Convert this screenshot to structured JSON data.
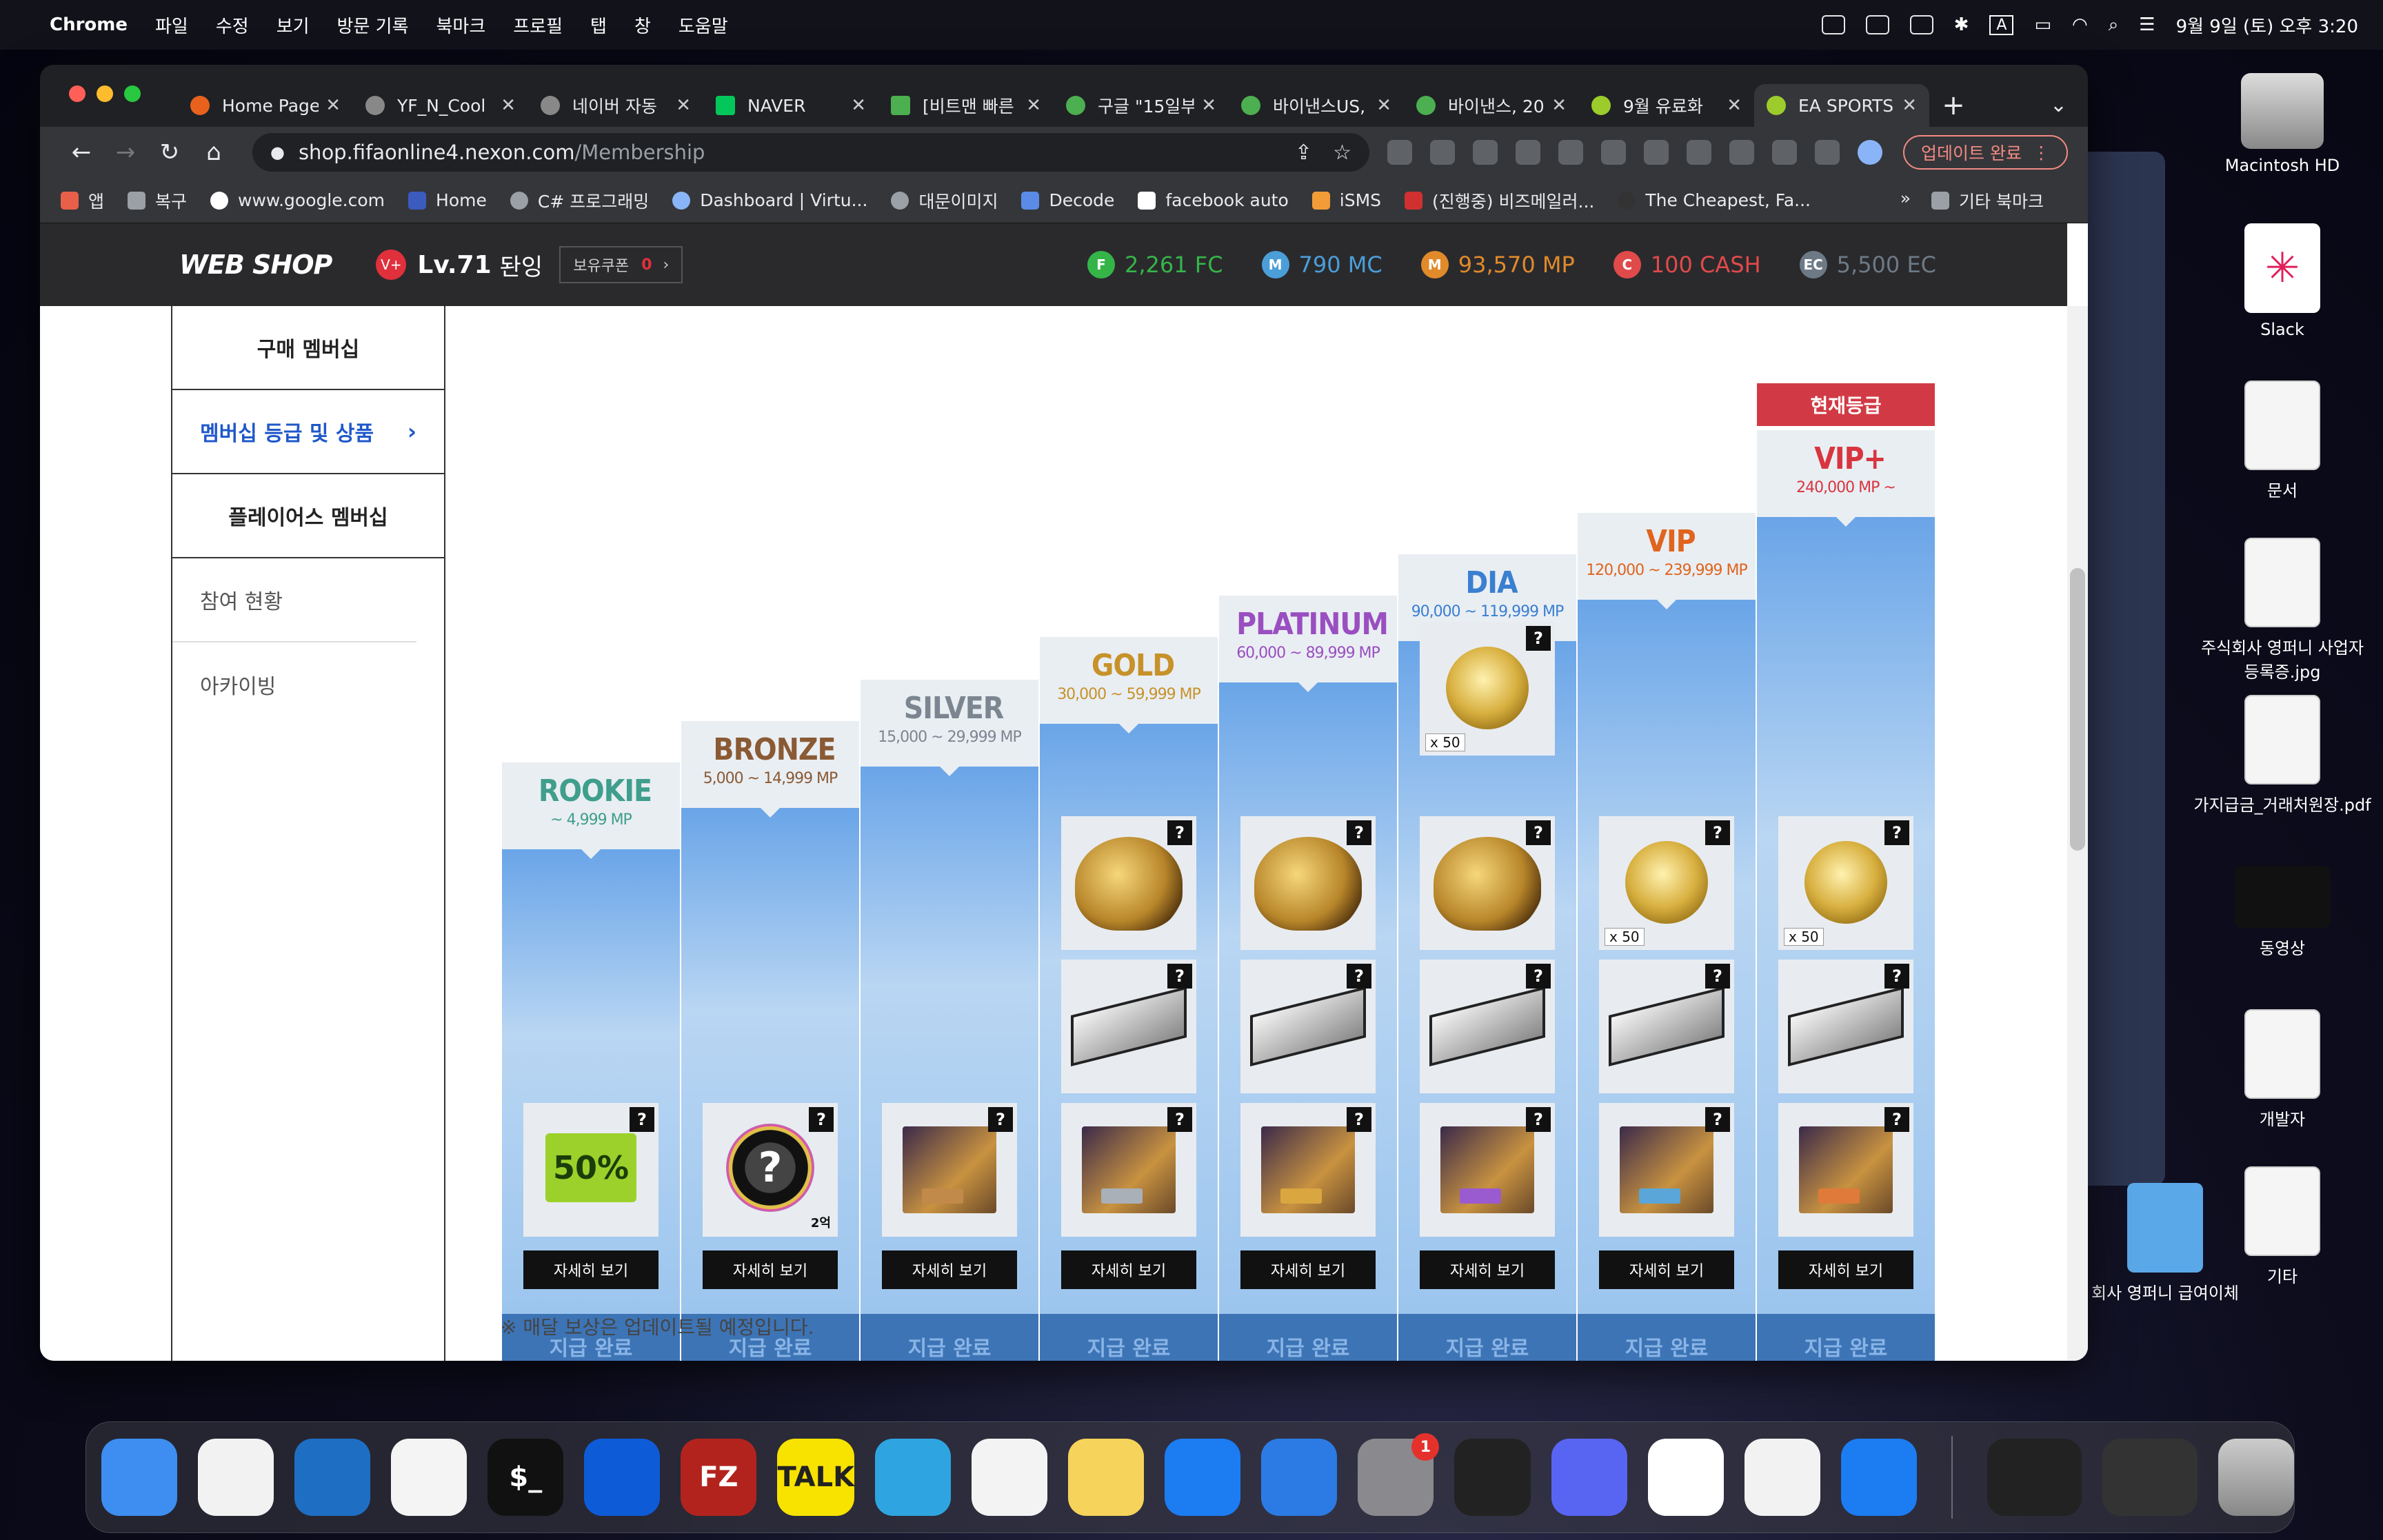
{
  "menubar": {
    "app": "Chrome",
    "items": [
      "파일",
      "수정",
      "보기",
      "방문 기록",
      "북마크",
      "프로필",
      "탭",
      "창",
      "도움말"
    ],
    "clock": "9월 9일 (토) 오후 3:20",
    "input_indicator": "A"
  },
  "tabs": [
    {
      "title": "Home Page"
    },
    {
      "title": "YF_N_Cool"
    },
    {
      "title": "네이버 자동"
    },
    {
      "title": "NAVER"
    },
    {
      "title": "[비트맨 빠른"
    },
    {
      "title": "구글 \"15일부"
    },
    {
      "title": "바이낸스US,"
    },
    {
      "title": "바이낸스, 20"
    },
    {
      "title": "9월 유료화"
    },
    {
      "title": "EA SPORTS"
    }
  ],
  "toolbar": {
    "url_host": "shop.fifaonline4.nexon.com",
    "url_path": "/Membership",
    "update_label": "업데이트 완료"
  },
  "bookmarks": [
    "앱",
    "복구",
    "www.google.com",
    "Home",
    "C# 프로그래밍",
    "Dashboard | Virtu...",
    "대문이미지",
    "Decode",
    "facebook auto",
    "iSMS",
    "(진행중) 비즈메일러...",
    "The Cheapest, Fa..."
  ],
  "bookmarks_more": "»",
  "bookmarks_other": "기타 북마크",
  "shop": {
    "logo": "WEB SHOP",
    "level": "Lv.71",
    "user": "돤잉",
    "coupon_label": "보유쿠폰",
    "coupon_count": "0",
    "currencies": [
      {
        "icon": "F",
        "label": "2,261 FC",
        "color": "#35b548"
      },
      {
        "icon": "M",
        "label": "790 MC",
        "color": "#4b9ed8"
      },
      {
        "icon": "M",
        "label": "93,570 MP",
        "color": "#e08a2a"
      },
      {
        "icon": "C",
        "label": "100 CASH",
        "color": "#e04a4a"
      },
      {
        "icon": "EC",
        "label": "5,500 EC",
        "color": "#6d7a86"
      }
    ]
  },
  "sidebar": {
    "items": [
      "구매 멤버십",
      "멤버십 등급 및 상품",
      "플레이어스 멤버십"
    ],
    "subs": [
      "참여 현황",
      "아카이빙"
    ]
  },
  "tiers": [
    {
      "name": "ROOKIE",
      "range": "~ 4,999 MP",
      "color": "#3f9e8c",
      "status": "지급 완료",
      "detail": "자세히 보기"
    },
    {
      "name": "BRONZE",
      "range": "5,000 ~ 14,999 MP",
      "color": "#8a5a34",
      "status": "지급 완료",
      "detail": "자세히 보기"
    },
    {
      "name": "SILVER",
      "range": "15,000 ~ 29,999 MP",
      "color": "#7c8690",
      "status": "지급 완료",
      "detail": "자세히 보기"
    },
    {
      "name": "GOLD",
      "range": "30,000 ~ 59,999 MP",
      "color": "#c7922a",
      "status": "지급 완료",
      "detail": "자세히 보기"
    },
    {
      "name": "PLATINUM",
      "range": "60,000 ~ 89,999 MP",
      "color": "#9a4fc0",
      "status": "지급 완료",
      "detail": "자세히 보기"
    },
    {
      "name": "DIA",
      "range": "90,000 ~ 119,999 MP",
      "color": "#3a7fd0",
      "status": "지급 완료",
      "detail": "자세히 보기"
    },
    {
      "name": "VIP",
      "range": "120,000 ~ 239,999 MP",
      "color": "#e0641e",
      "status": "지급 완료",
      "detail": "자세히 보기"
    },
    {
      "name": "VIP+",
      "range": "240,000 MP ~",
      "color": "#d8353f",
      "status": "지급 완료",
      "detail": "자세히 보기"
    }
  ],
  "rewards": {
    "question_mark": "?",
    "coupon_text": "50%",
    "mystery_text": "?",
    "mystery_caption": "2억",
    "multiplier": "x 50"
  },
  "current_tier_label": "현재등급",
  "footnote": "※ 매달 보상은 업데이트될 예정입니다.",
  "desktop_icons": [
    {
      "label": "Macintosh HD"
    },
    {
      "label": "Slack"
    },
    {
      "label": "문서"
    },
    {
      "label": "주식회사 영퍼니 사업자 등록증.jpg"
    },
    {
      "label": "가지급금_거래처원장.pdf"
    },
    {
      "label": "동영상"
    },
    {
      "label": "개발자"
    },
    {
      "label": "기타"
    }
  ],
  "desktop_left_label": "회사 영퍼니 급여이체",
  "dock": {
    "apps": [
      {
        "name": "finder",
        "glyph": "",
        "color": "#3d8ef0"
      },
      {
        "name": "chrome",
        "glyph": "",
        "color": "#f2f2f2"
      },
      {
        "name": "vscode",
        "glyph": "",
        "color": "#1e6fc4"
      },
      {
        "name": "android-studio",
        "glyph": "",
        "color": "#f4f4f4"
      },
      {
        "name": "terminal",
        "glyph": "$_",
        "color": "#111"
      },
      {
        "name": "teamviewer",
        "glyph": "",
        "color": "#0e5bd8"
      },
      {
        "name": "filezilla",
        "glyph": "FZ",
        "color": "#b3231e"
      },
      {
        "name": "kakaotalk",
        "glyph": "TALK",
        "color": "#f7e200"
      },
      {
        "name": "telegram",
        "glyph": "",
        "color": "#2ea5e0"
      },
      {
        "name": "photos",
        "glyph": "",
        "color": "#f3f3f3"
      },
      {
        "name": "notes",
        "glyph": "",
        "color": "#f6d35a"
      },
      {
        "name": "app-store",
        "glyph": "",
        "color": "#1c7cf2"
      },
      {
        "name": "xcode",
        "glyph": "",
        "color": "#2c7be5"
      },
      {
        "name": "system-settings",
        "glyph": "",
        "color": "#8a8a8e",
        "badge": "1"
      },
      {
        "name": "activity-monitor",
        "glyph": "",
        "color": "#222"
      },
      {
        "name": "discord",
        "glyph": "",
        "color": "#5865f2"
      },
      {
        "name": "slack",
        "glyph": "",
        "color": "#fff"
      },
      {
        "name": "chrome-2",
        "glyph": "",
        "color": "#f2f2f2"
      },
      {
        "name": "simulator",
        "glyph": "",
        "color": "#1c7cf2"
      }
    ]
  }
}
